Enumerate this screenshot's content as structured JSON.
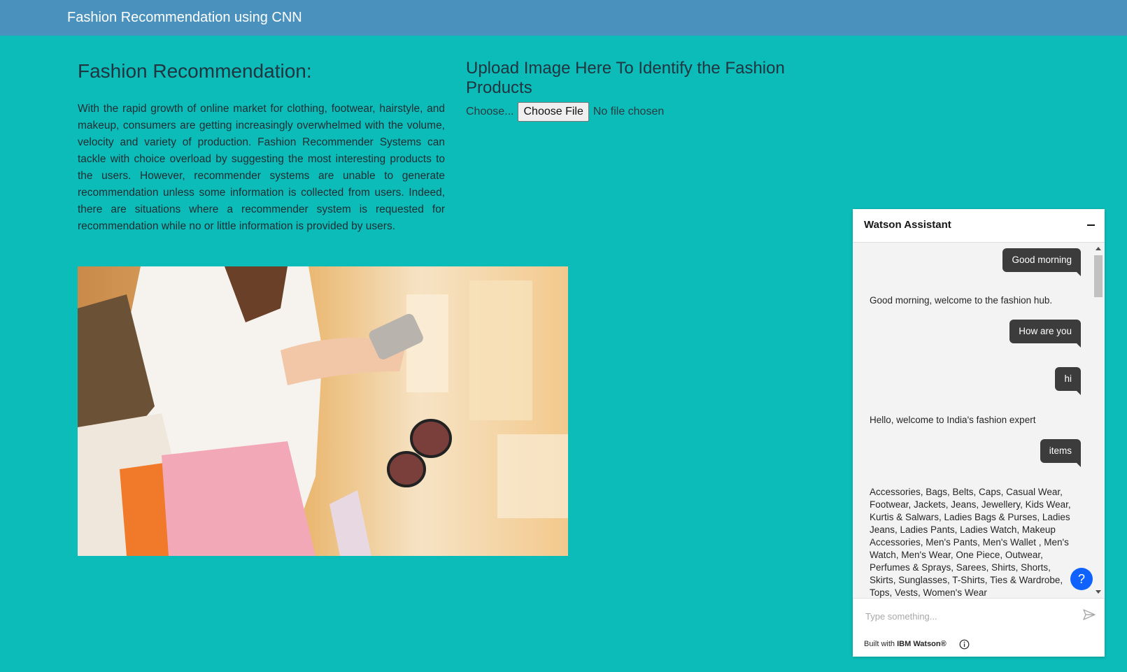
{
  "navbar": {
    "brand": "Fashion Recommendation using CNN"
  },
  "main": {
    "title": "Fashion Recommendation:",
    "description": "With the rapid growth of online market for clothing, footwear, hairstyle, and makeup, consumers are getting increasingly overwhelmed with the volume, velocity and variety of production. Fashion Recommender Systems can tackle with choice overload by suggesting the most interesting products to the users. However, recommender systems are unable to generate recommendation unless some information is collected from users. Indeed, there are situations where a recommender system is requested for recommendation while no or little information is provided by users."
  },
  "upload": {
    "title": "Upload Image Here To Identify the Fashion Products",
    "choose_label": "Choose...",
    "button_label": "Choose File",
    "status": "No file chosen"
  },
  "chat": {
    "title": "Watson Assistant",
    "messages": [
      {
        "from": "user",
        "text": "Good morning"
      },
      {
        "from": "bot",
        "text": "Good morning, welcome to the fashion hub."
      },
      {
        "from": "user",
        "text": "How are you"
      },
      {
        "from": "user",
        "text": "hi"
      },
      {
        "from": "bot",
        "text": "Hello, welcome to India's fashion expert"
      },
      {
        "from": "user",
        "text": "items"
      },
      {
        "from": "bot",
        "text": "Accessories, Bags, Belts, Caps, Casual Wear, Footwear, Jackets, Jeans, Jewellery, Kids Wear, Kurtis & Salwars, Ladies Bags & Purses, Ladies Jeans, Ladies Pants, Ladies Watch, Makeup Accessories, Men's Pants, Men's Wallet , Men's Watch, Men's Wear, One Piece, Outwear, Perfumes & Sprays, Sarees, Shirts, Shorts, Skirts, Sunglasses, T-Shirts, Ties & Wardrobe, Tops, Vests, Women's Wear"
      }
    ],
    "input_placeholder": "Type something...",
    "help_label": "?",
    "footer_prefix": "Built with",
    "footer_brand": "IBM Watson®"
  },
  "colors": {
    "background": "#0bbcb8",
    "navbar": "#4a92bd",
    "user_bubble": "#3c3c3c",
    "help_button": "#0f62fe"
  }
}
